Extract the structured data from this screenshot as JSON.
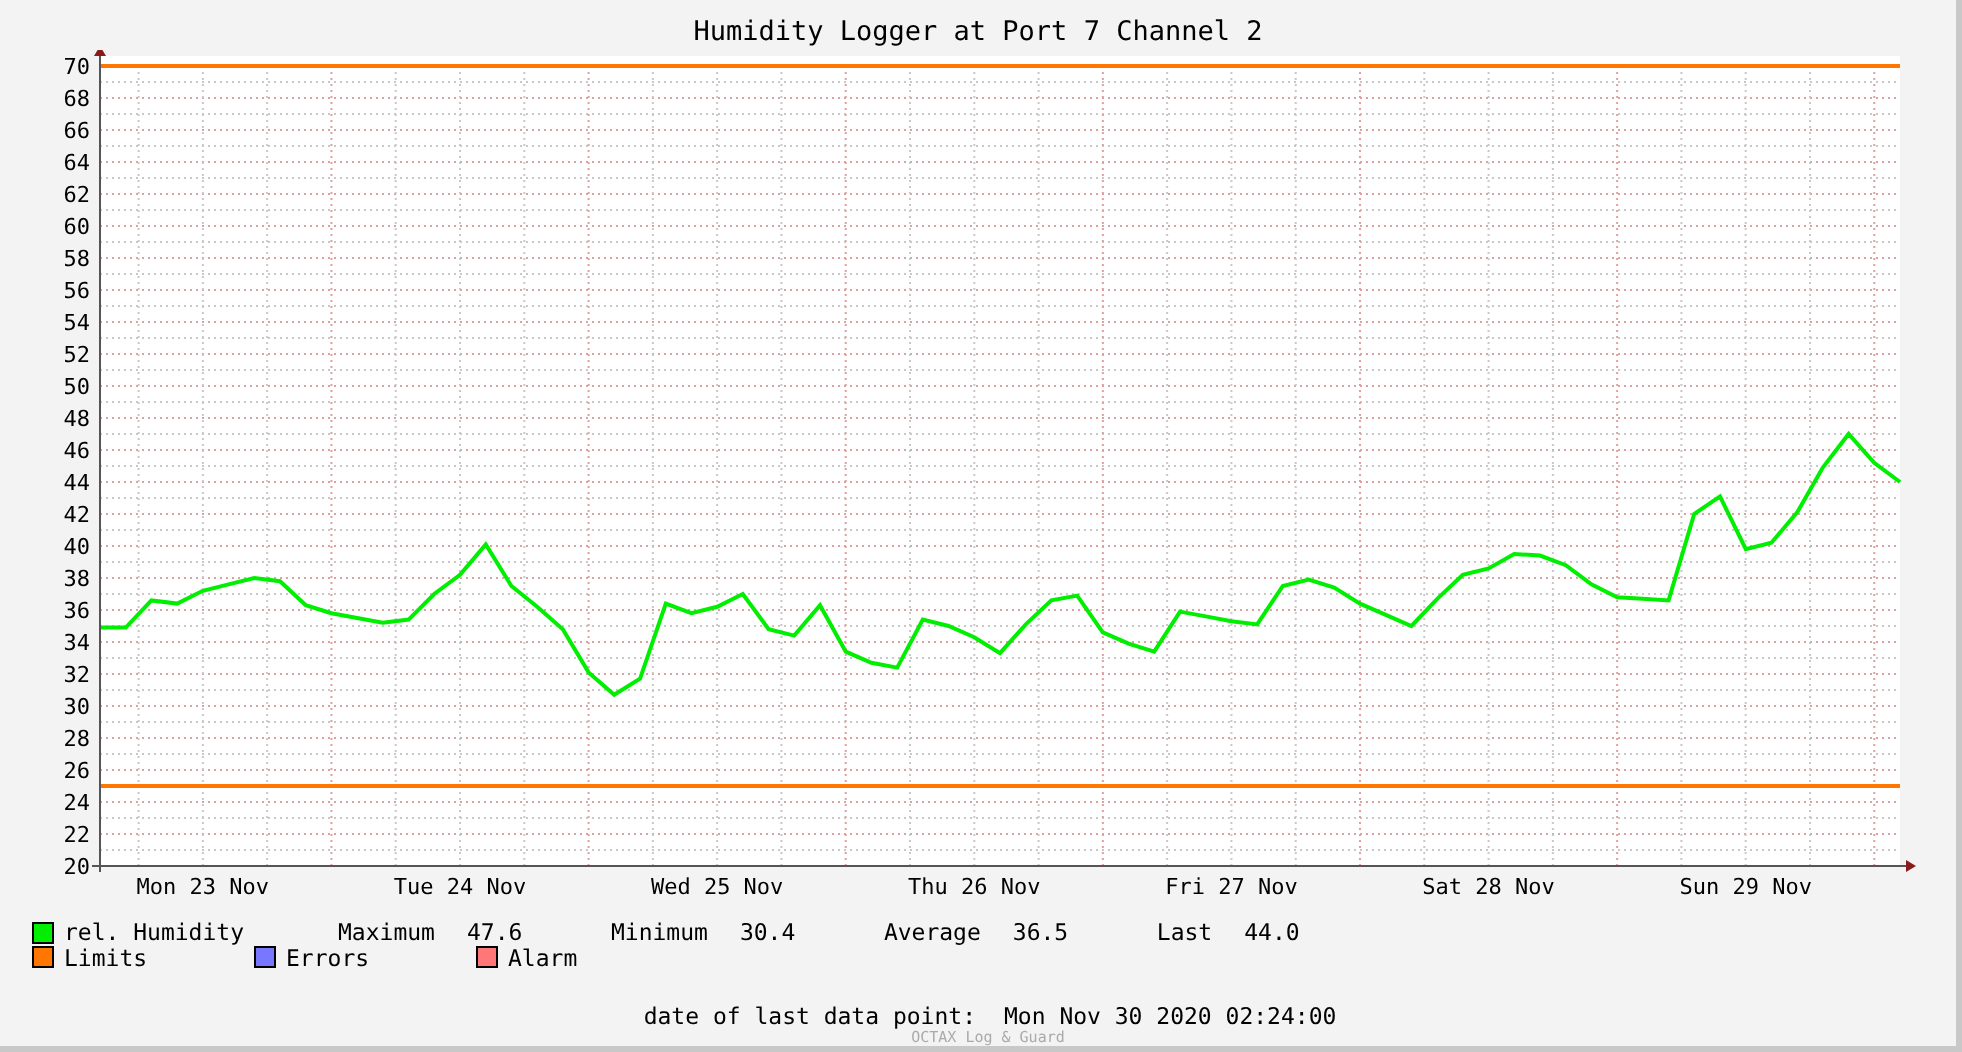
{
  "chart_data": {
    "type": "line",
    "title": "Humidity Logger at Port 7 Channel 2",
    "categories": [
      null,
      null,
      null,
      null,
      "Mon 23 Nov",
      null,
      null,
      null,
      null,
      null,
      null,
      null,
      null,
      null,
      "Tue 24 Nov",
      null,
      null,
      null,
      null,
      null,
      null,
      null,
      null,
      null,
      "Wed 25 Nov",
      null,
      null,
      null,
      null,
      null,
      null,
      null,
      null,
      null,
      "Thu 26 Nov",
      null,
      null,
      null,
      null,
      null,
      null,
      null,
      null,
      null,
      "Fri 27 Nov",
      null,
      null,
      null,
      null,
      null,
      null,
      null,
      null,
      null,
      "Sat 28 Nov",
      null,
      null,
      null,
      null,
      null,
      null,
      null,
      null,
      null,
      "Sun 29 Nov",
      null,
      null,
      null,
      null,
      null,
      null
    ],
    "series": [
      {
        "name": "rel. Humidity",
        "color": "#00ee00",
        "values": [
          34.9,
          34.9,
          36.6,
          36.4,
          37.2,
          37.6,
          38.0,
          37.8,
          36.3,
          35.8,
          35.5,
          35.2,
          35.4,
          37.0,
          38.2,
          40.1,
          37.5,
          36.2,
          34.8,
          32.1,
          30.7,
          31.7,
          36.4,
          35.8,
          36.2,
          37.0,
          34.8,
          34.4,
          36.3,
          33.4,
          32.7,
          32.4,
          35.4,
          35.0,
          34.3,
          33.3,
          35.1,
          36.6,
          36.9,
          34.6,
          33.9,
          33.4,
          35.9,
          35.6,
          35.3,
          35.1,
          37.5,
          37.9,
          37.4,
          36.4,
          35.7,
          35.0,
          36.7,
          38.2,
          38.6,
          39.5,
          39.4,
          38.8,
          37.6,
          36.8,
          36.7,
          36.6,
          42.0,
          43.1,
          39.8,
          40.2,
          42.1,
          44.9,
          47.0,
          45.2,
          44.0
        ]
      }
    ],
    "ylim": [
      20,
      70
    ],
    "yticks": [
      20,
      22,
      24,
      26,
      28,
      30,
      32,
      34,
      36,
      38,
      40,
      42,
      44,
      46,
      48,
      50,
      52,
      54,
      56,
      58,
      60,
      62,
      64,
      66,
      68,
      70
    ],
    "grid": true,
    "ref_lines": [
      {
        "axis": "y",
        "value": 70
      },
      {
        "axis": "y",
        "value": 25
      }
    ]
  },
  "stats": [
    {
      "label": "Maximum",
      "value": "47.6"
    },
    {
      "label": "Minimum",
      "value": "30.4"
    },
    {
      "label": "Average",
      "value": "36.5"
    },
    {
      "label": "Last",
      "value": "44.0"
    }
  ],
  "legend": [
    {
      "name": "Limits",
      "color": "#ff7700"
    },
    {
      "name": "Errors",
      "color": "#7777ff"
    },
    {
      "name": "Alarm",
      "color": "#ff7777"
    }
  ],
  "last_data_point": {
    "label": "date of last data point:",
    "value": "Mon Nov 30 2020 02:24:00"
  },
  "credit": "OCTAX Log & Guard"
}
